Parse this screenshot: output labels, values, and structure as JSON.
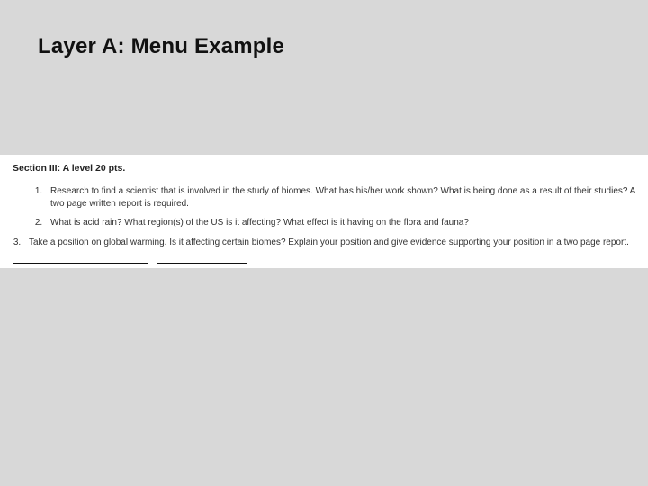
{
  "slide": {
    "title": "Layer A: Menu Example"
  },
  "document": {
    "section_header": "Section III: A level 20 pts.",
    "items": [
      "Research to find a scientist that is involved in the study of biomes.  What has his/her work shown?  What is being done as a result of their studies?  A two page written report is required.",
      "What is acid rain? What region(s) of the US is it affecting? What effect is it having on the flora and fauna?",
      "Take a position on global warming.  Is it affecting certain biomes?  Explain your position and give evidence supporting your position in a two page report."
    ]
  }
}
